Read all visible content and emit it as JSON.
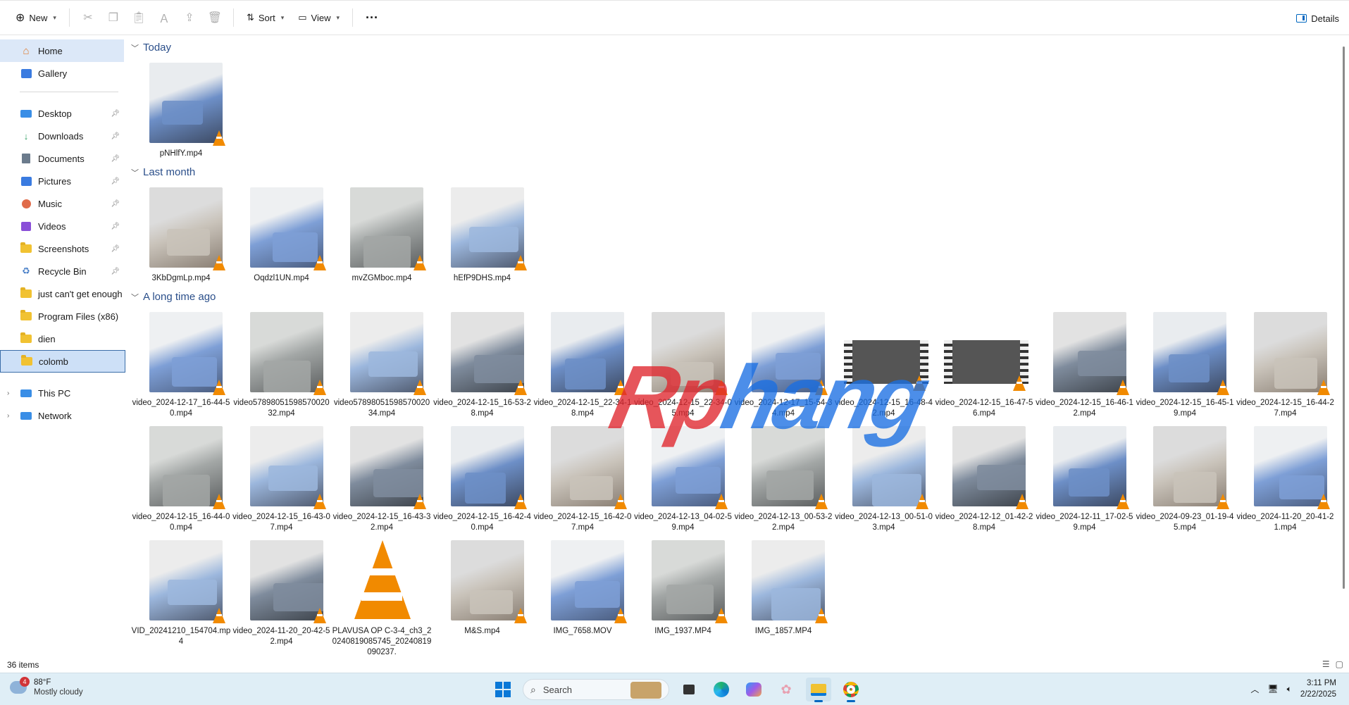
{
  "toolbar": {
    "new_label": "New",
    "sort_label": "Sort",
    "view_label": "View",
    "more_label": "···",
    "details_label": "Details"
  },
  "sidebar": {
    "top": [
      {
        "label": "Home",
        "icon": "home-icon"
      },
      {
        "label": "Gallery",
        "icon": "gallery-icon"
      }
    ],
    "pinned": [
      {
        "label": "Desktop",
        "icon": "desktop-icon",
        "color": "#3a8ee6"
      },
      {
        "label": "Downloads",
        "icon": "download-icon",
        "color": "#2e9e63"
      },
      {
        "label": "Documents",
        "icon": "documents-icon",
        "color": "#6b7b8c"
      },
      {
        "label": "Pictures",
        "icon": "pictures-icon",
        "color": "#3a7be0"
      },
      {
        "label": "Music",
        "icon": "music-icon",
        "color": "#e06b4a"
      },
      {
        "label": "Videos",
        "icon": "videos-icon",
        "color": "#8a4fd8"
      },
      {
        "label": "Screenshots",
        "icon": "folder-icon",
        "color": "#f1c232"
      },
      {
        "label": "Recycle Bin",
        "icon": "recycle-bin-icon",
        "color": "#4a80c8"
      }
    ],
    "folders": [
      {
        "label": "just can't get enough"
      },
      {
        "label": "Program Files (x86)"
      },
      {
        "label": "dien"
      },
      {
        "label": "colomb"
      }
    ],
    "bottom": [
      {
        "label": "This PC",
        "icon": "this-pc-icon"
      },
      {
        "label": "Network",
        "icon": "network-icon"
      }
    ]
  },
  "groups": {
    "today": {
      "title": "Today",
      "files": [
        "pNHlfY.mp4"
      ]
    },
    "last_month": {
      "title": "Last month",
      "files": [
        "3KbDgmLp.mp4",
        "Oqdzl1UN.mp4",
        "mvZGMboc.mp4",
        "hEfP9DHS.mp4"
      ]
    },
    "long_ago": {
      "title": "A long time ago",
      "row1": [
        "video_2024-12-17_16-44-50.mp4",
        "video5789805159857002032.mp4",
        "video5789805159857002034.mp4",
        "video_2024-12-15_16-53-28.mp4",
        "video_2024-12-15_22-34-18.mp4",
        "video_2024-12-15_22-34-05.mp4",
        "video_2024-12-17_15-54-34.mp4",
        "video_2024-12-15_16-48-42.mp4",
        "video_2024-12-15_16-47-56.mp4",
        "video_2024-12-15_16-46-12.mp4",
        "video_2024-12-15_16-45-19.mp4",
        "video_2024-12-15_16-44-27.mp4"
      ],
      "row2": [
        "video_2024-12-15_16-44-00.mp4",
        "video_2024-12-15_16-43-07.mp4",
        "video_2024-12-15_16-43-32.mp4",
        "video_2024-12-15_16-42-40.mp4",
        "video_2024-12-15_16-42-07.mp4",
        "video_2024-12-13_04-02-59.mp4",
        "video_2024-12-13_00-53-22.mp4",
        "video_2024-12-13_00-51-03.mp4",
        "video_2024-12-12_01-42-28.mp4",
        "video_2024-12-11_17-02-59.mp4",
        "video_2024-09-23_01-19-45.mp4",
        "video_2024-11-20_20-41-21.mp4"
      ],
      "row3": [
        "VID_20241210_154704.mp4",
        "video_2024-11-20_20-42-52.mp4",
        "PLAVUSA OP C-3-4_ch3_20240819085745_20240819090237.",
        "M&S.mp4",
        "IMG_7658.MOV",
        "IMG_1937.MP4",
        "IMG_1857.MP4"
      ]
    }
  },
  "status": {
    "item_count": "36 items"
  },
  "taskbar": {
    "weather_temp": "88°F",
    "weather_desc": "Mostly cloudy",
    "weather_badge": "4",
    "search_placeholder": "Search",
    "time": "3:11 PM",
    "date": "2/22/2025"
  },
  "watermark": {
    "part1": "Rp",
    "part2": "hang"
  },
  "colors": {
    "accent": "#0067c0",
    "group_header": "#2b4f8a",
    "vlc_orange": "#f18a00"
  }
}
